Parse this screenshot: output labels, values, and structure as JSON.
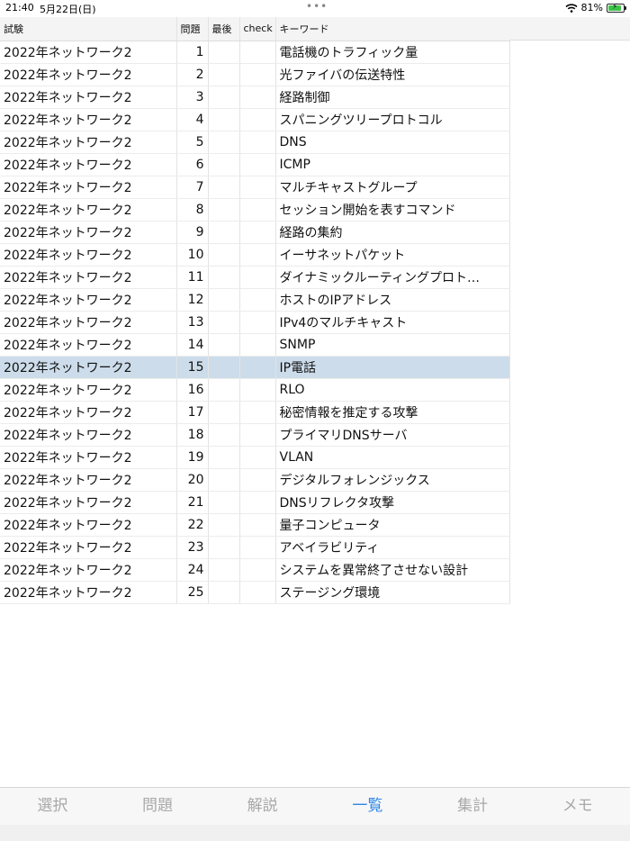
{
  "status": {
    "time": "21:40",
    "date": "5月22日(日)",
    "battery": "81%"
  },
  "table": {
    "headers": [
      "試験",
      "問題",
      "最後",
      "check",
      "キーワード"
    ],
    "selected_row": 14,
    "rows": [
      {
        "exam": "2022年ネットワーク2",
        "num": "1",
        "last": "",
        "check": "",
        "keyword": "電話機のトラフィック量"
      },
      {
        "exam": "2022年ネットワーク2",
        "num": "2",
        "last": "",
        "check": "",
        "keyword": "光ファイバの伝送特性"
      },
      {
        "exam": "2022年ネットワーク2",
        "num": "3",
        "last": "",
        "check": "",
        "keyword": "経路制御"
      },
      {
        "exam": "2022年ネットワーク2",
        "num": "4",
        "last": "",
        "check": "",
        "keyword": "スパニングツリープロトコル"
      },
      {
        "exam": "2022年ネットワーク2",
        "num": "5",
        "last": "",
        "check": "",
        "keyword": "DNS"
      },
      {
        "exam": "2022年ネットワーク2",
        "num": "6",
        "last": "",
        "check": "",
        "keyword": "ICMP"
      },
      {
        "exam": "2022年ネットワーク2",
        "num": "7",
        "last": "",
        "check": "",
        "keyword": "マルチキャストグループ"
      },
      {
        "exam": "2022年ネットワーク2",
        "num": "8",
        "last": "",
        "check": "",
        "keyword": "セッション開始を表すコマンド"
      },
      {
        "exam": "2022年ネットワーク2",
        "num": "9",
        "last": "",
        "check": "",
        "keyword": "経路の集約"
      },
      {
        "exam": "2022年ネットワーク2",
        "num": "10",
        "last": "",
        "check": "",
        "keyword": "イーサネットパケット"
      },
      {
        "exam": "2022年ネットワーク2",
        "num": "11",
        "last": "",
        "check": "",
        "keyword": "ダイナミックルーティングプロト…"
      },
      {
        "exam": "2022年ネットワーク2",
        "num": "12",
        "last": "",
        "check": "",
        "keyword": "ホストのIPアドレス"
      },
      {
        "exam": "2022年ネットワーク2",
        "num": "13",
        "last": "",
        "check": "",
        "keyword": "IPv4のマルチキャスト"
      },
      {
        "exam": "2022年ネットワーク2",
        "num": "14",
        "last": "",
        "check": "",
        "keyword": "SNMP"
      },
      {
        "exam": "2022年ネットワーク2",
        "num": "15",
        "last": "",
        "check": "",
        "keyword": "IP電話"
      },
      {
        "exam": "2022年ネットワーク2",
        "num": "16",
        "last": "",
        "check": "",
        "keyword": "RLO"
      },
      {
        "exam": "2022年ネットワーク2",
        "num": "17",
        "last": "",
        "check": "",
        "keyword": "秘密情報を推定する攻撃"
      },
      {
        "exam": "2022年ネットワーク2",
        "num": "18",
        "last": "",
        "check": "",
        "keyword": "プライマリDNSサーバ"
      },
      {
        "exam": "2022年ネットワーク2",
        "num": "19",
        "last": "",
        "check": "",
        "keyword": "VLAN"
      },
      {
        "exam": "2022年ネットワーク2",
        "num": "20",
        "last": "",
        "check": "",
        "keyword": "デジタルフォレンジックス"
      },
      {
        "exam": "2022年ネットワーク2",
        "num": "21",
        "last": "",
        "check": "",
        "keyword": "DNSリフレクタ攻撃"
      },
      {
        "exam": "2022年ネットワーク2",
        "num": "22",
        "last": "",
        "check": "",
        "keyword": "量子コンピュータ"
      },
      {
        "exam": "2022年ネットワーク2",
        "num": "23",
        "last": "",
        "check": "",
        "keyword": "アベイラビリティ"
      },
      {
        "exam": "2022年ネットワーク2",
        "num": "24",
        "last": "",
        "check": "",
        "keyword": "システムを異常終了させない設計"
      },
      {
        "exam": "2022年ネットワーク2",
        "num": "25",
        "last": "",
        "check": "",
        "keyword": "ステージング環境"
      }
    ]
  },
  "tabs": [
    {
      "label": "選択",
      "active": false
    },
    {
      "label": "問題",
      "active": false
    },
    {
      "label": "解説",
      "active": false
    },
    {
      "label": "一覧",
      "active": true
    },
    {
      "label": "集計",
      "active": false
    },
    {
      "label": "メモ",
      "active": false
    }
  ],
  "colors": {
    "accent": "#2f87e6",
    "selected_row": "#ccdcea",
    "inactive_tab": "#a8a8a8"
  }
}
